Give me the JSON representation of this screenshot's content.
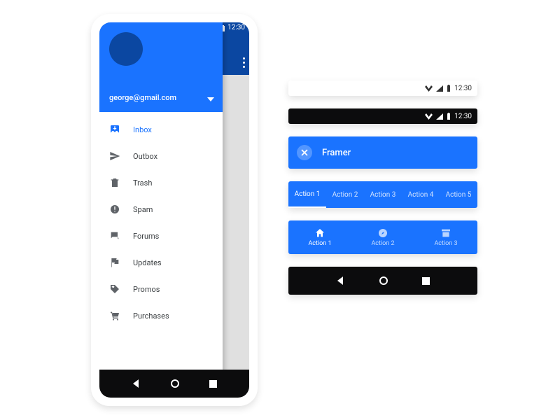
{
  "colors": {
    "blue": "#1A73FF",
    "blueDark": "#0B47A1",
    "black": "#0C0C0D"
  },
  "phone": {
    "statusTime": "12:30",
    "account": {
      "email": "george@gmail.com"
    },
    "drawerItems": [
      {
        "icon": "inbox",
        "label": "Inbox",
        "active": true
      },
      {
        "icon": "send",
        "label": "Outbox",
        "active": false
      },
      {
        "icon": "trash",
        "label": "Trash",
        "active": false
      },
      {
        "icon": "spam",
        "label": "Spam",
        "active": false
      },
      {
        "icon": "forums",
        "label": "Forums",
        "active": false
      },
      {
        "icon": "flag",
        "label": "Updates",
        "active": false
      },
      {
        "icon": "tag",
        "label": "Promos",
        "active": false
      },
      {
        "icon": "cart",
        "label": "Purchases",
        "active": false
      }
    ]
  },
  "statusbars": {
    "time": "12:30"
  },
  "appbar": {
    "title": "Framer"
  },
  "tabs5": [
    {
      "label": "Action 1"
    },
    {
      "label": "Action 2"
    },
    {
      "label": "Action 3"
    },
    {
      "label": "Action 4"
    },
    {
      "label": "Action 5"
    }
  ],
  "tabs5ActiveIndex": 0,
  "bottomNav": [
    {
      "icon": "home",
      "label": "Action 1"
    },
    {
      "icon": "compass",
      "label": "Action 2"
    },
    {
      "icon": "archive",
      "label": "Action 3"
    }
  ],
  "bottomNavActiveIndex": 0
}
